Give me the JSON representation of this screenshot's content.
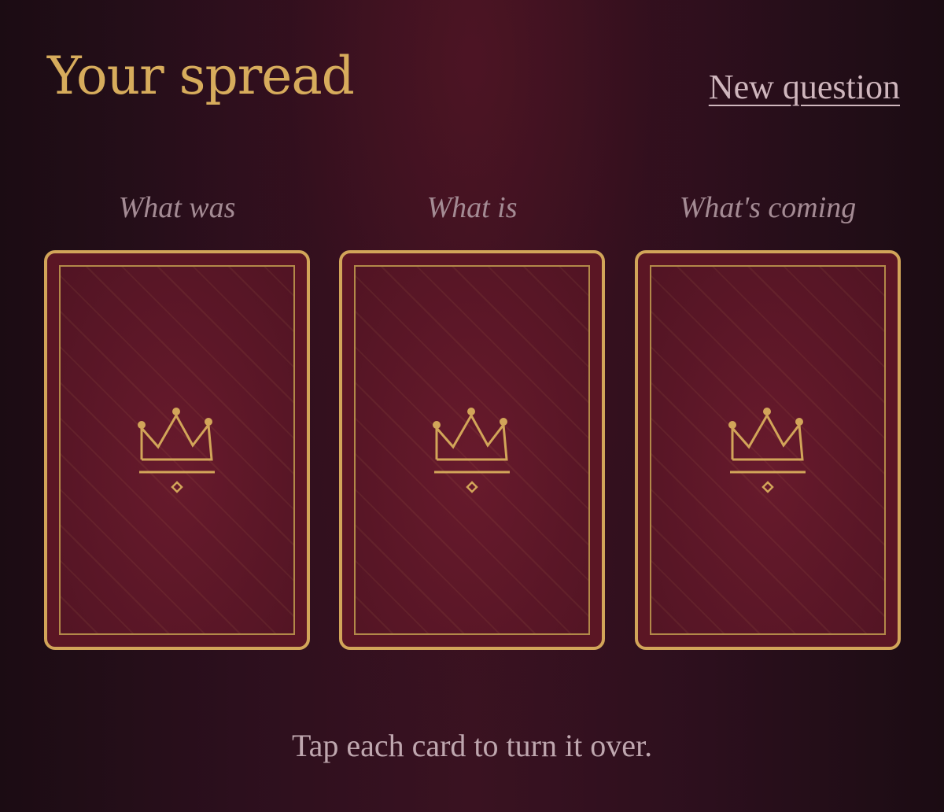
{
  "header": {
    "title": "Your spread",
    "new_question_label": "New question"
  },
  "spread": {
    "cards": [
      {
        "position_label": "What was",
        "face": "down",
        "emblem": "crown-icon"
      },
      {
        "position_label": "What is",
        "face": "down",
        "emblem": "crown-icon"
      },
      {
        "position_label": "What's coming",
        "face": "down",
        "emblem": "crown-icon"
      }
    ]
  },
  "footer": {
    "hint": "Tap each card to turn it over."
  },
  "colors": {
    "gold": "#d2a559",
    "title_gold": "#d7ac5c",
    "background": "#2c0f1d",
    "card_back": "#5b1624",
    "muted_text": "#a48b94"
  }
}
